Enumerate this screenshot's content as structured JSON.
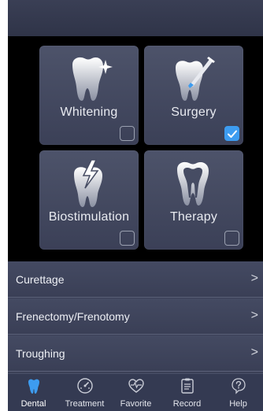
{
  "colors": {
    "accent": "#3d9cf0",
    "background": "#000000",
    "card": "#464c63",
    "tabbar": "#343a52"
  },
  "categories": [
    {
      "label": "Whitening",
      "icon": "tooth-sparkle-icon",
      "checked": false
    },
    {
      "label": "Surgery",
      "icon": "tooth-scalpel-icon",
      "checked": true
    },
    {
      "label": "Biostimulation",
      "icon": "tooth-lightning-icon",
      "checked": false
    },
    {
      "label": "Therapy",
      "icon": "tooth-root-icon",
      "checked": false
    }
  ],
  "procedures": [
    {
      "label": "Curettage"
    },
    {
      "label": "Frenectomy/Frenotomy"
    },
    {
      "label": "Troughing"
    }
  ],
  "chevron": ">",
  "tabs": [
    {
      "label": "Dental",
      "icon": "tooth-icon",
      "active": true
    },
    {
      "label": "Treatment",
      "icon": "gauge-icon",
      "active": false
    },
    {
      "label": "Favorite",
      "icon": "heart-pulse-icon",
      "active": false
    },
    {
      "label": "Record",
      "icon": "clipboard-icon",
      "active": false
    },
    {
      "label": "Help",
      "icon": "help-icon",
      "active": false
    }
  ]
}
